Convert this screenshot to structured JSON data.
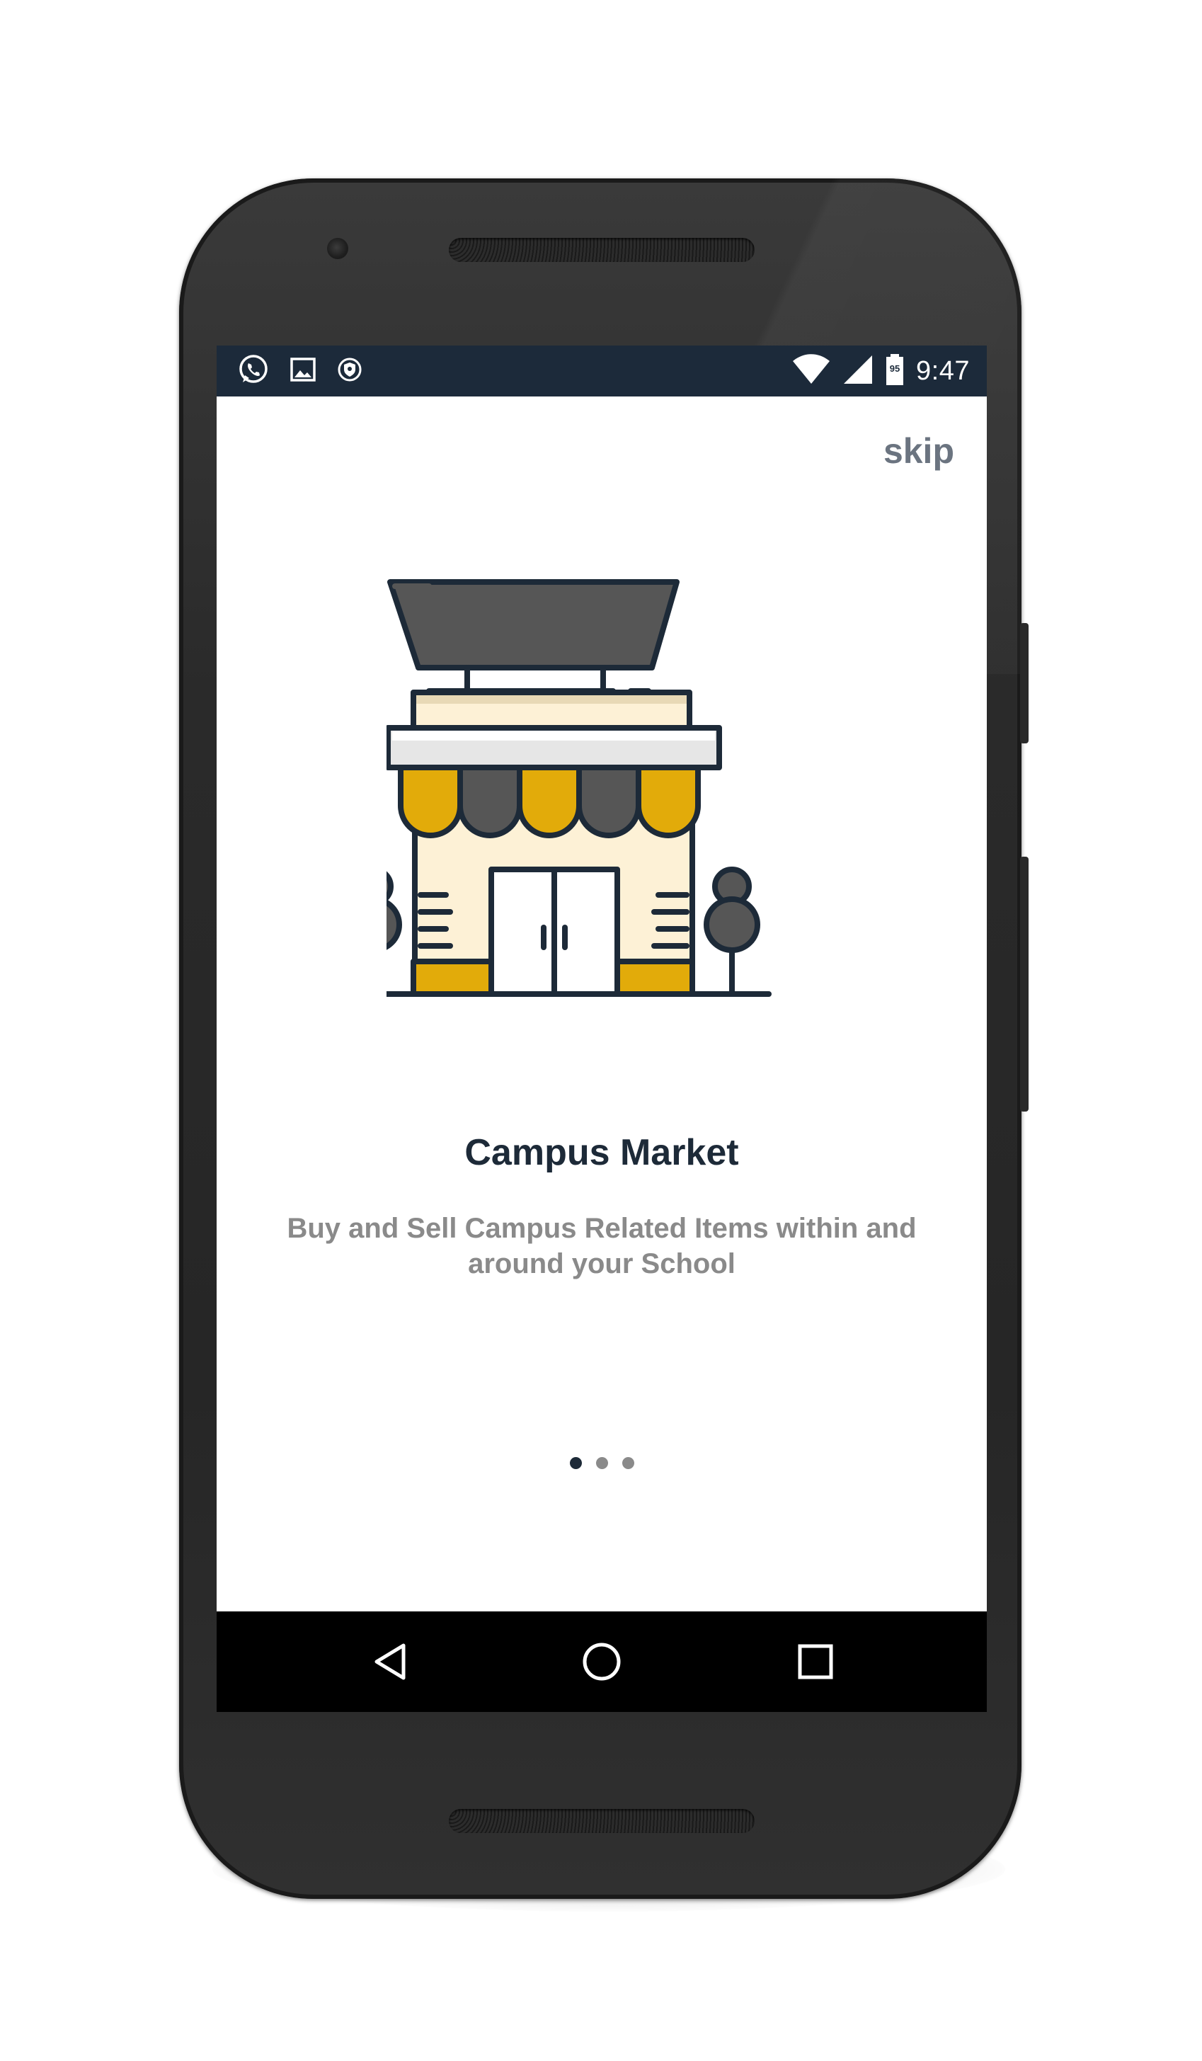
{
  "status_bar": {
    "left_icons": [
      "whatsapp-icon",
      "gallery-icon",
      "shield-icon"
    ],
    "right_icons": [
      "wifi-icon",
      "signal-icon",
      "battery-icon"
    ],
    "battery_level": "95",
    "time": "9:47"
  },
  "onboarding": {
    "skip_label": "skip",
    "illustration": "storefront-illustration",
    "title": "Campus Market",
    "description": "Buy and Sell Campus Related Items within and around your School",
    "pages": 3,
    "active_page": 1
  },
  "nav_bar": {
    "buttons": [
      "back-icon",
      "home-icon",
      "recents-icon"
    ]
  },
  "colors": {
    "status_bar": "#1c2a3a",
    "title": "#1d2a38",
    "subtitle": "#8a8a8a",
    "skip": "#6b7480",
    "accent_yellow": "#e2ab0a",
    "awning_gray": "#565656",
    "wall_cream": "#fdf1d6",
    "outline": "#1d2a38"
  }
}
